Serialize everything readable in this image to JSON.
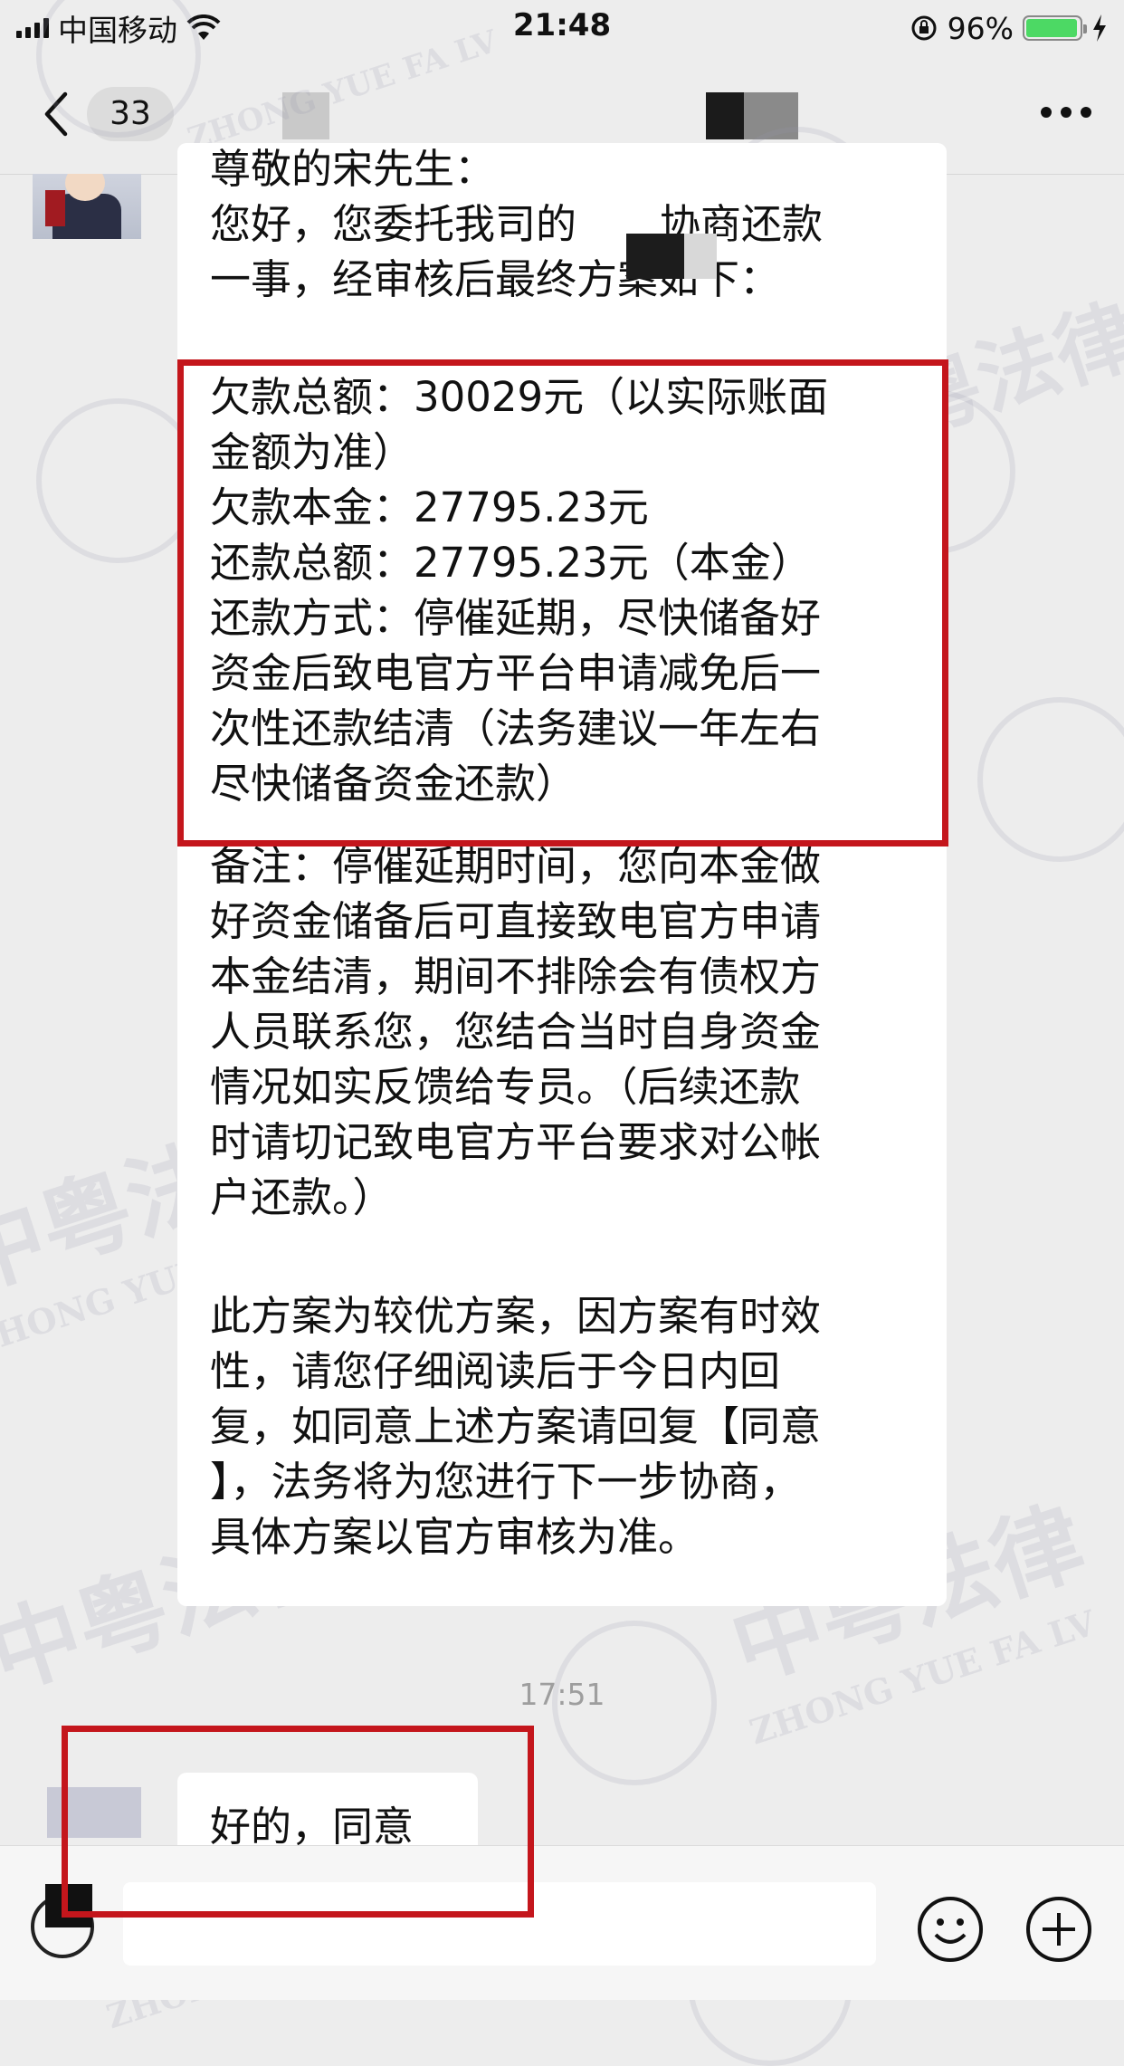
{
  "status_bar": {
    "carrier": "中国移动",
    "time": "21:48",
    "battery": "96%",
    "battery_level": 0.96
  },
  "nav": {
    "unread_count": "33"
  },
  "messages": {
    "lines_1": [
      "尊敬的宋先生：",
      "您好，您委托我司的",
      "一事，经审核后最终方案如下："
    ],
    "line_1b_suffix": "协商还款",
    "lines_2": [
      "欠款总额：30029元（以实际账面",
      "金额为准）",
      "欠款本金：27795.23元",
      "还款总额：27795.23元（本金）",
      "还款方式：停催延期，尽快储备好",
      "资金后致电官方平台申请减免后一",
      "次性还款结清（法务建议一年左右",
      "尽快储备资金还款）"
    ],
    "lines_3": [
      "备注：停催延期时间，您向本金做",
      "好资金储备后可直接致电官方申请",
      "本金结清，期间不排除会有债权方",
      "人员联系您，您结合当时自身资金",
      "情况如实反馈给专员。（后续还款",
      "时请切记致电官方平台要求对公帐",
      "户还款。）"
    ],
    "lines_4": [
      "此方案为较优方案，因方案有时效",
      "性，请您仔细阅读后于今日内回",
      "复，如同意上述方案请回复【同意",
      "】，法务将为您进行下一步协商，",
      "具体方案以官方审核为准。"
    ],
    "timestamp": "17:51",
    "reply": "好的，同意"
  },
  "watermark": {
    "cn": "中粤法律",
    "en": "ZHONG YUE FA LV"
  },
  "colors": {
    "highlight_red": "#c4161c",
    "background": "#ededed",
    "bubble": "#ffffff"
  }
}
